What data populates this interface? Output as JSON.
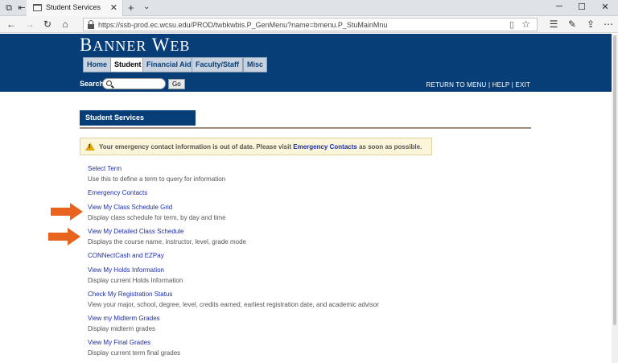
{
  "browser": {
    "tab_title": "Student Services",
    "url": "https://ssb-prod.ec.wcsu.edu/PROD/twbkwbis.P_GenMenu?name=bmenu.P_StuMainMnu"
  },
  "header": {
    "logo_big1": "B",
    "logo_small1": "ANNER",
    "logo_big2": "W",
    "logo_small2": "EB",
    "tabs": [
      "Home",
      "Student",
      "Financial Aid",
      "Faculty/Staff",
      "Misc"
    ],
    "active_tab": "Student",
    "search_label": "Search",
    "go_label": "Go",
    "links": [
      "RETURN TO MENU",
      "HELP",
      "EXIT"
    ],
    "link_sep": "|"
  },
  "main": {
    "section_title": "Student Services",
    "warning": {
      "prefix": "Your emergency contact information is out of date. Please visit ",
      "link": "Emergency Contacts",
      "suffix": " as soon as possible."
    },
    "items": [
      {
        "link": "Select Term",
        "desc": "Use this to define a term to query for information"
      },
      {
        "link": "Emergency Contacts",
        "desc": ""
      },
      {
        "link": "View My Class Schedule Grid",
        "desc": "Display class schedule for term, by day and time"
      },
      {
        "link": "View My Detailed Class Schedule",
        "desc": "Displays the course name, instructor, level, grade mode"
      },
      {
        "link": "CONNectCash and EZPay",
        "desc": ""
      },
      {
        "link": "View My Holds Information",
        "desc": "Display current Holds Information"
      },
      {
        "link": "Check My Registration Status",
        "desc": "View your major, school, degree, level, credits earned, earliest registration date, and academic advisor"
      },
      {
        "link": "View my Midterm Grades",
        "desc": "Display midterm grades"
      },
      {
        "link": "View My Final Grades",
        "desc": "Display current term final grades"
      }
    ]
  },
  "colors": {
    "banner": "#083e78",
    "link": "#1e2fa8",
    "arrow": "#e8641e"
  }
}
